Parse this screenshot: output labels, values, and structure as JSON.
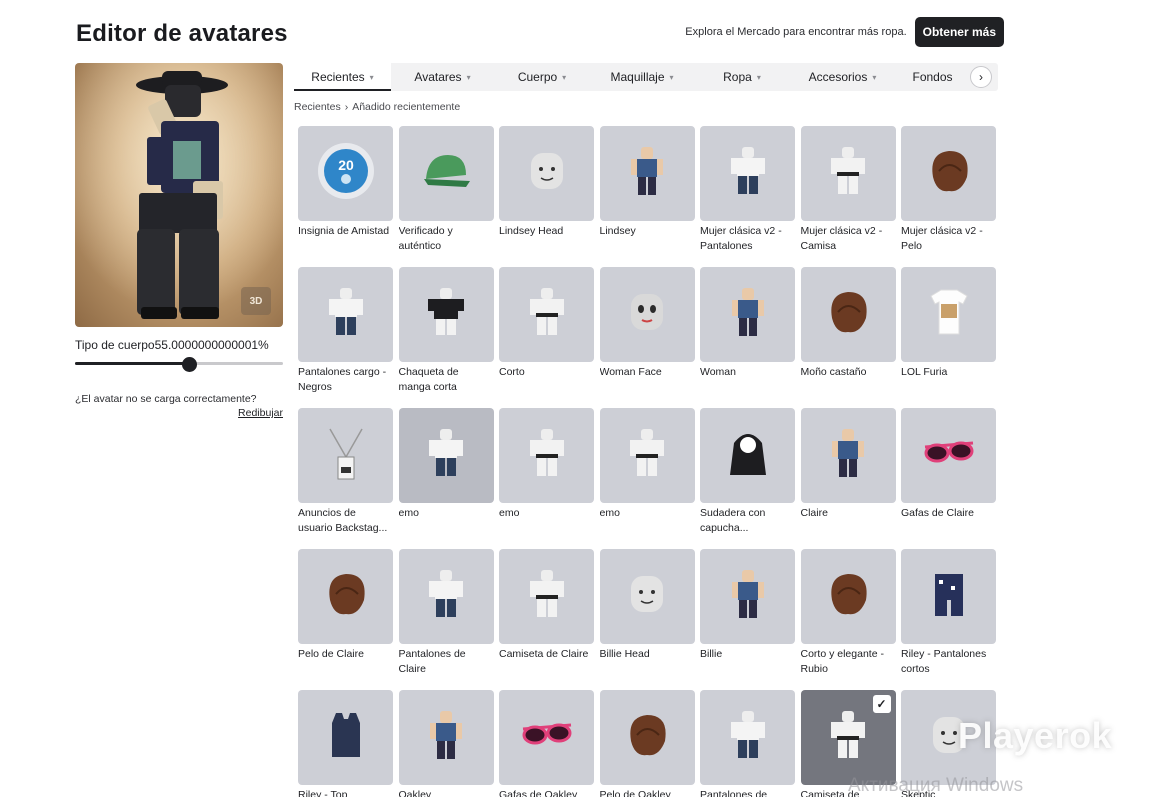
{
  "header": {
    "title": "Editor de avatares",
    "promo_text": "Explora el Mercado para encontrar más ropa.",
    "get_more_label": "Obtener más"
  },
  "preview": {
    "view_3d_label": "3D",
    "body_type_label": "Tipo de cuerpo",
    "body_type_value": "55.0000000000001%",
    "body_type_fraction": 0.55,
    "reload_question": "¿El avatar no se carga correctamente?",
    "reload_link": "Redibujar"
  },
  "tabs": [
    {
      "label": "Recientes",
      "active": true
    },
    {
      "label": "Avatares",
      "active": false
    },
    {
      "label": "Cuerpo",
      "active": false
    },
    {
      "label": "Maquillaje",
      "active": false
    },
    {
      "label": "Ropa",
      "active": false
    },
    {
      "label": "Accesorios",
      "active": false
    },
    {
      "label": "Fondos",
      "active": false
    }
  ],
  "breadcrumb": {
    "root": "Recientes",
    "separator": "›",
    "current": "Añadido recientemente"
  },
  "items": [
    {
      "name": "Insignia de Amistad",
      "icon": "badge-icon"
    },
    {
      "name": "Verificado y auténtico",
      "icon": "cap-icon"
    },
    {
      "name": "Lindsey Head",
      "icon": "head-icon"
    },
    {
      "name": "Lindsey",
      "icon": "character-icon"
    },
    {
      "name": "Mujer clásica v2 - Pantalones",
      "icon": "pants-icon"
    },
    {
      "name": "Mujer clásica v2 - Camisa",
      "icon": "shirt-icon"
    },
    {
      "name": "Mujer clásica v2 - Pelo",
      "icon": "hair-icon"
    },
    {
      "name": "Pantalones cargo - Negros",
      "icon": "pants-icon"
    },
    {
      "name": "Chaqueta de manga corta",
      "icon": "jacket-icon"
    },
    {
      "name": "Corto",
      "icon": "shirt-icon"
    },
    {
      "name": "Woman Face",
      "icon": "face-icon"
    },
    {
      "name": "Woman",
      "icon": "character-icon"
    },
    {
      "name": "Moño castaño",
      "icon": "hair-icon"
    },
    {
      "name": "LOL Furia",
      "icon": "tshirt-icon"
    },
    {
      "name": "Anuncios de usuario Backstag...",
      "icon": "lanyard-icon"
    },
    {
      "name": "emo",
      "icon": "pants-icon",
      "grey": true
    },
    {
      "name": "emo",
      "icon": "shirt-icon"
    },
    {
      "name": "emo",
      "icon": "shirt-icon"
    },
    {
      "name": "Sudadera con capucha...",
      "icon": "hoodie-icon"
    },
    {
      "name": "Claire",
      "icon": "character-icon"
    },
    {
      "name": "Gafas de Claire",
      "icon": "glasses-icon"
    },
    {
      "name": "Pelo de Claire",
      "icon": "hair-icon"
    },
    {
      "name": "Pantalones de Claire",
      "icon": "pants-icon"
    },
    {
      "name": "Camiseta de Claire",
      "icon": "shirt-icon"
    },
    {
      "name": "Billie Head",
      "icon": "head-icon"
    },
    {
      "name": "Billie",
      "icon": "character-icon"
    },
    {
      "name": "Corto y elegante - Rubio",
      "icon": "hair-icon"
    },
    {
      "name": "Riley - Pantalones cortos",
      "icon": "shorts-icon"
    },
    {
      "name": "Riley - Top",
      "icon": "tank-top-icon"
    },
    {
      "name": "Oakley",
      "icon": "character-icon"
    },
    {
      "name": "Gafas de Oakley",
      "icon": "glasses-icon"
    },
    {
      "name": "Pelo de Oakley",
      "icon": "hair-icon"
    },
    {
      "name": "Pantalones de",
      "icon": "pants-icon"
    },
    {
      "name": "Camiseta de",
      "icon": "shirt-icon",
      "selected": true,
      "dark": true
    },
    {
      "name": "Skeptic",
      "icon": "head-icon"
    }
  ],
  "watermark": "Playerok",
  "system_overlay": "Активация Windows",
  "colors": {
    "accent": "#202124",
    "tile": "#cdcfd6",
    "tab_bar": "#f2f2f3"
  }
}
